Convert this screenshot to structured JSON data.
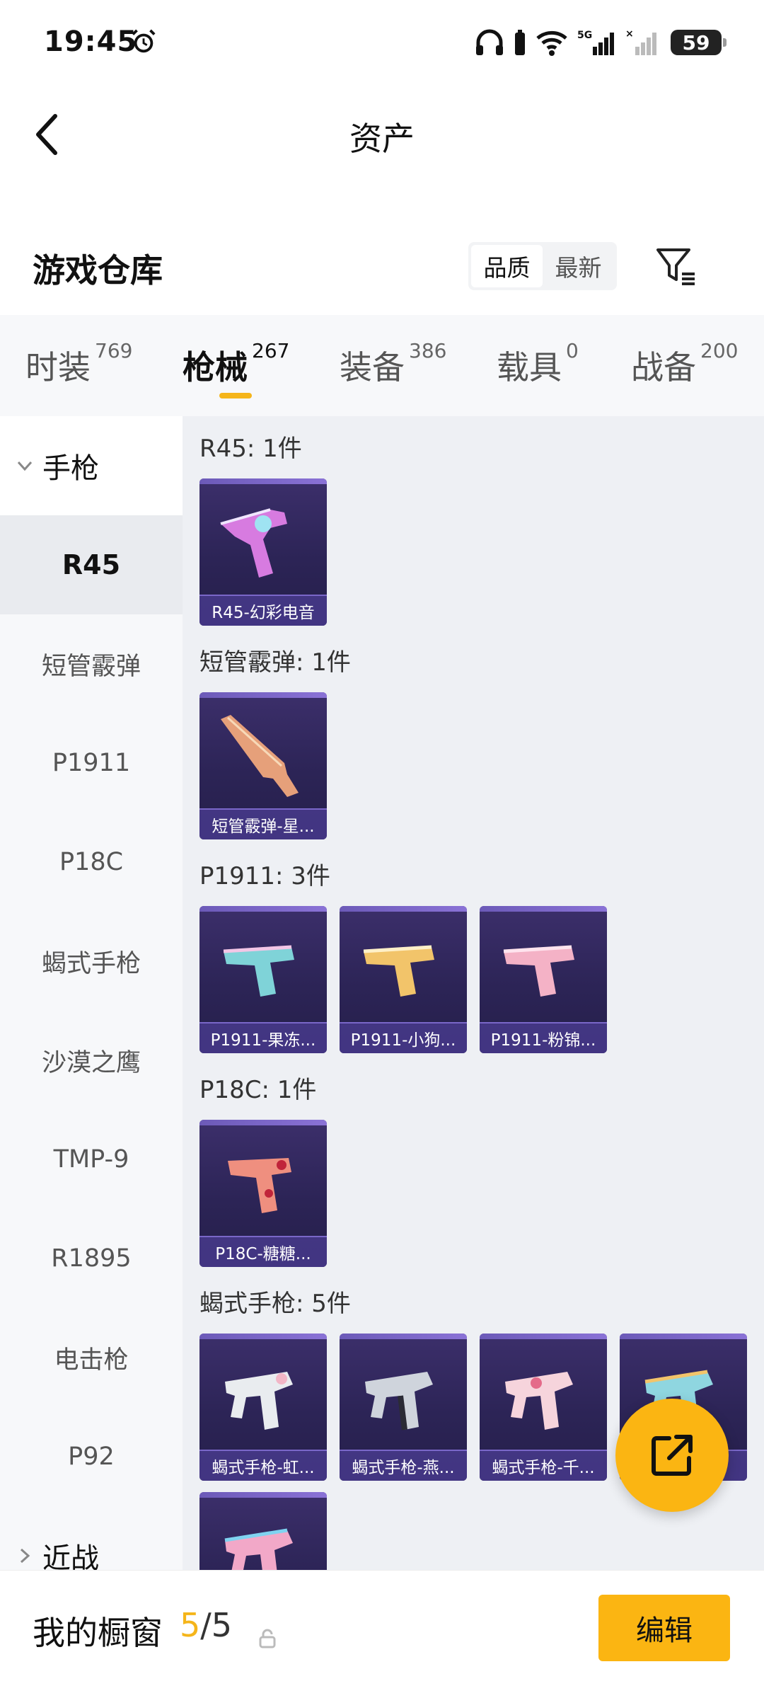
{
  "status_bar": {
    "time": "19:45",
    "battery": "59",
    "icons": [
      "alarm-icon",
      "headphones-icon",
      "wifi-icon",
      "signal-5g-icon",
      "signal-icon",
      "battery-icon"
    ]
  },
  "header": {
    "title": "资产",
    "back_icon": "chevron-left-icon"
  },
  "warehouse": {
    "title": "游戏仓库",
    "sort_options": [
      "品质",
      "最新"
    ],
    "selected_sort": "品质",
    "filter_icon": "filter-icon"
  },
  "tabs": [
    {
      "label": "时装",
      "count": "769"
    },
    {
      "label": "枪械",
      "count": "267"
    },
    {
      "label": "装备",
      "count": "386"
    },
    {
      "label": "载具",
      "count": "0"
    },
    {
      "label": "战备",
      "count": "200"
    }
  ],
  "active_tab": "枪械",
  "sidebar": {
    "group_expanded": "手枪",
    "items": [
      "R45",
      "短管霰弹",
      "P1911",
      "P18C",
      "蝎式手枪",
      "沙漠之鹰",
      "TMP-9",
      "R1895",
      "电击枪",
      "P92"
    ],
    "active_item": "R45",
    "group_collapsed": "近战"
  },
  "sections": [
    {
      "title": "R45: 1件",
      "items": [
        "R45-幻彩电音"
      ]
    },
    {
      "title": "短管霰弹: 1件",
      "items": [
        "短管霰弹-星..."
      ]
    },
    {
      "title": "P1911: 3件",
      "items": [
        "P1911-果冻...",
        "P1911-小狗...",
        "P1911-粉锦..."
      ]
    },
    {
      "title": "P18C: 1件",
      "items": [
        "P18C-糖糖..."
      ]
    },
    {
      "title": "蝎式手枪: 5件",
      "items": [
        "蝎式手枪-虹...",
        "蝎式手枪-燕...",
        "蝎式手枪-千...",
        ""
      ]
    }
  ],
  "bottom_bar": {
    "label": "我的橱窗",
    "count_current": "5",
    "count_sep": "/",
    "count_total": "5",
    "edit_label": "编辑"
  },
  "fab_icon": "share-external-icon",
  "colors": {
    "accent": "#fbb512",
    "card_bg": "#2c2456",
    "content_bg": "#eef0f4"
  }
}
